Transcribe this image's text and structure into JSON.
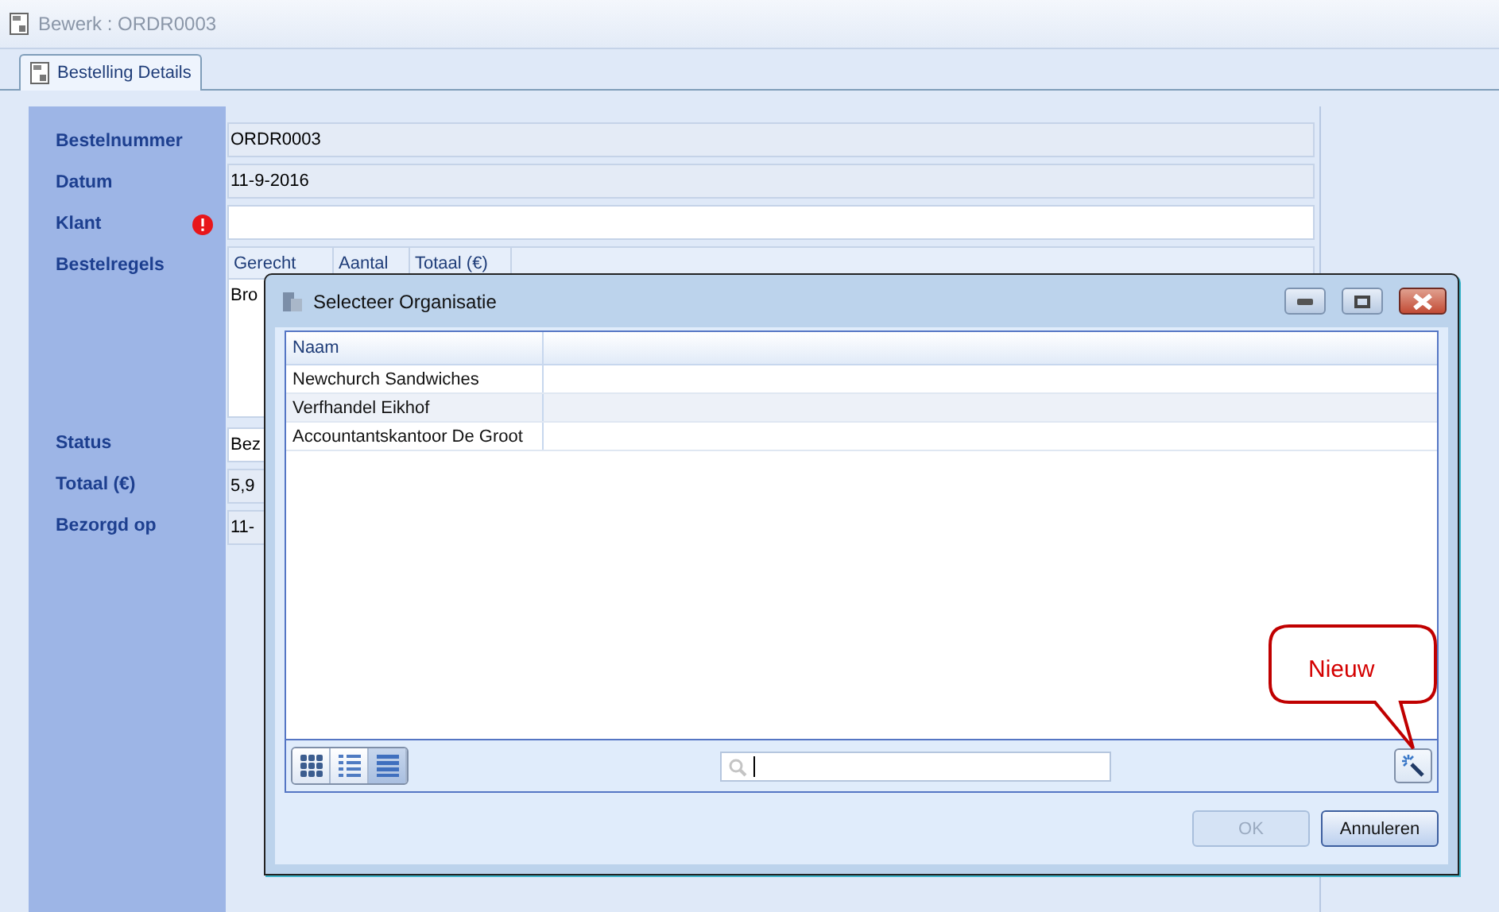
{
  "window": {
    "title": "Bewerk : ORDR0003"
  },
  "tabs": [
    {
      "label": "Bestelling Details",
      "selected": true
    }
  ],
  "form": {
    "fields": [
      {
        "label": "Bestelnummer",
        "value": "ORDR0003",
        "required_error": false,
        "kind": "readonly"
      },
      {
        "label": "Datum",
        "value": "11-9-2016",
        "required_error": false,
        "kind": "readonly"
      },
      {
        "label": "Klant",
        "required_error": true,
        "kind": "input"
      },
      {
        "label": "Bestelregels",
        "kind": "grid",
        "columns": [
          "Gerecht",
          "Aantal",
          "Totaal (€)"
        ],
        "rows": [
          [
            "Bro"
          ]
        ]
      },
      {
        "label": "Status",
        "value": "Bez",
        "required_error": false,
        "kind": "input"
      },
      {
        "label": "Totaal (€)",
        "value": "5,9",
        "required_error": false,
        "kind": "readonly"
      },
      {
        "label": "Bezorgd op",
        "value": "11-",
        "required_error": false,
        "kind": "readonly"
      }
    ]
  },
  "dialog": {
    "title": "Selecteer Organisatie",
    "table": {
      "columns": [
        "Naam"
      ],
      "rows": [
        {
          "naam": "Newchurch Sandwiches",
          "selected": false
        },
        {
          "naam": "Verfhandel Eikhof",
          "selected": false
        },
        {
          "naam": "Accountantskantoor De Groot",
          "selected": false
        }
      ]
    },
    "view_modes": [
      {
        "kind": "tiles",
        "selected": false
      },
      {
        "kind": "list",
        "selected": false
      },
      {
        "kind": "details",
        "selected": true
      }
    ],
    "callout": {
      "text": "Nieuw"
    },
    "buttons": [
      {
        "label": "OK",
        "disabled": true
      },
      {
        "label": "Annuleren",
        "disabled": false
      }
    ]
  }
}
